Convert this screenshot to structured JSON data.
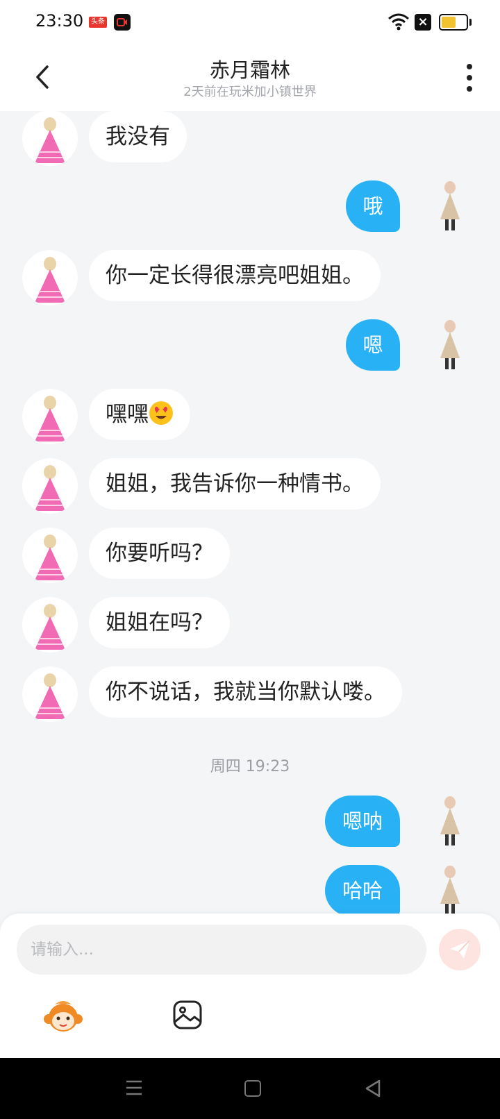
{
  "status_bar": {
    "time": "23:30",
    "app_badge": "头条",
    "battery_color": "#f2c230"
  },
  "header": {
    "title": "赤月霜林",
    "subtitle": "2天前在玩米加小镇世界"
  },
  "messages": [
    {
      "side": "left",
      "text": "我没有"
    },
    {
      "side": "right",
      "text": "哦"
    },
    {
      "side": "left",
      "text": "你一定长得很漂亮吧姐姐。"
    },
    {
      "side": "right",
      "text": "嗯"
    },
    {
      "side": "left",
      "text": "嘿嘿",
      "emoji": "heart-eyes-emoji"
    },
    {
      "side": "left",
      "text": "姐姐，我告诉你一种情书。"
    },
    {
      "side": "left",
      "text": "你要听吗？"
    },
    {
      "side": "left",
      "text": "姐姐在吗？"
    },
    {
      "side": "left",
      "text": " 你不说话，我就当你默认喽。"
    },
    {
      "side": "right",
      "text": "嗯呐"
    },
    {
      "side": "right",
      "text": "哈哈"
    }
  ],
  "timestamp": "周四 19:23",
  "input": {
    "placeholder": "请输入..."
  },
  "colors": {
    "bubble_mine": "#29b1f5",
    "bubble_theirs": "#ffffff",
    "background": "#f4f5f7",
    "send_button": "#fde4e1"
  },
  "icons": {
    "back": "chevron-left-icon",
    "more": "more-vertical-icon",
    "send": "paper-plane-icon",
    "mascot": "monkey-mascot-icon",
    "image": "image-icon"
  }
}
